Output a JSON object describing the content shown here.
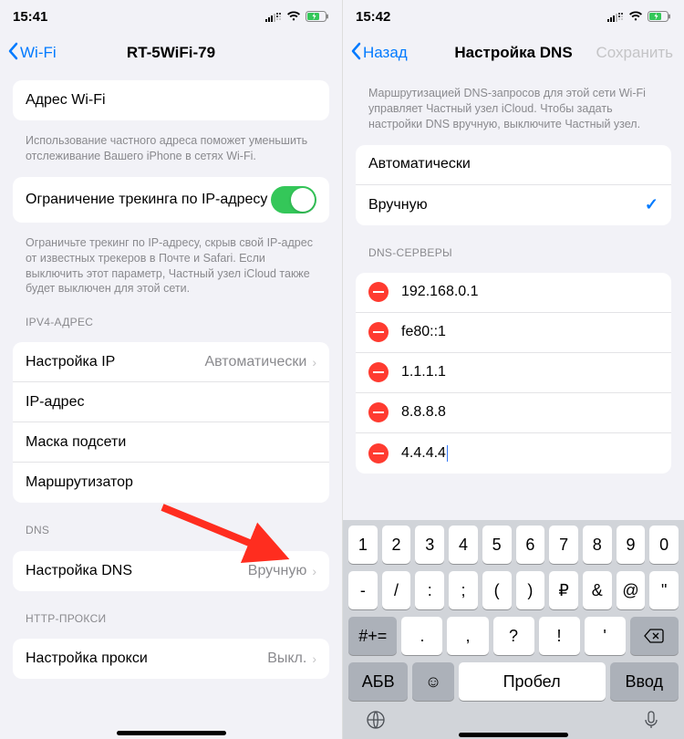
{
  "left": {
    "status_time": "15:41",
    "back_label": "Wi-Fi",
    "title": "RT-5WiFi-79",
    "wifi_address_label": "Адрес Wi-Fi",
    "wifi_address_footer": "Использование частного адреса поможет уменьшить отслеживание Вашего iPhone в сетях Wi-Fi.",
    "tracking_label": "Ограничение трекинга по IP-адресу",
    "tracking_footer": "Ограничьте трекинг по IP-адресу, скрыв свой IP-адрес от известных трекеров в Почте и Safari. Если выключить этот параметр, Частный узел iCloud также будет выключен для этой сети.",
    "ipv4_header": "IPV4-АДРЕС",
    "ip_config_label": "Настройка IP",
    "ip_config_value": "Автоматически",
    "ip_addr_label": "IP-адрес",
    "subnet_label": "Маска подсети",
    "router_label": "Маршрутизатор",
    "dns_header": "DNS",
    "dns_config_label": "Настройка DNS",
    "dns_config_value": "Вручную",
    "proxy_header": "HTTP-ПРОКСИ",
    "proxy_label": "Настройка прокси",
    "proxy_value": "Выкл."
  },
  "right": {
    "status_time": "15:42",
    "back_label": "Назад",
    "title": "Настройка DNS",
    "save_label": "Сохранить",
    "info_text": "Маршрутизацией DNS-запросов для этой сети Wi-Fi управляет Частный узел iCloud. Чтобы задать настройки DNS вручную, выключите Частный узел.",
    "mode_auto": "Автоматически",
    "mode_manual": "Вручную",
    "servers_header": "DNS-СЕРВЕРЫ",
    "servers": [
      "192.168.0.1",
      "fe80::1",
      "1.1.1.1",
      "8.8.8.8",
      "4.4.4.4"
    ],
    "keyboard": {
      "row1": [
        "1",
        "2",
        "3",
        "4",
        "5",
        "6",
        "7",
        "8",
        "9",
        "0"
      ],
      "row2": [
        "-",
        "/",
        ":",
        ";",
        "(",
        ")",
        "₽",
        "&",
        "@",
        "\""
      ],
      "row3_shift": "#+=",
      "row3": [
        ".",
        ",",
        "?",
        "!",
        "'"
      ],
      "abc": "АБВ",
      "space": "Пробел",
      "enter": "Ввод"
    }
  }
}
